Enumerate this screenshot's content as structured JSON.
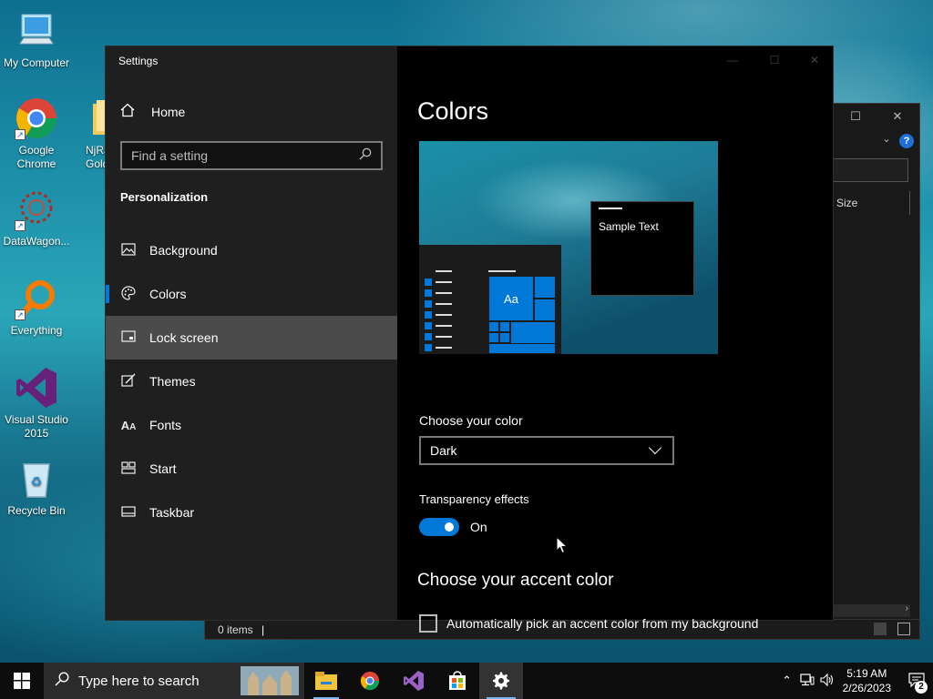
{
  "desktop": {
    "icons": [
      {
        "label": "My Computer"
      },
      {
        "label": "Google Chrome"
      },
      {
        "label": "NjRa Gold"
      },
      {
        "label": "DataWagon..."
      },
      {
        "label": "Everything"
      },
      {
        "label": "Visual Studio 2015"
      },
      {
        "label": "Recycle Bin"
      }
    ]
  },
  "explorer": {
    "column_size": "Size",
    "status_items": "0 items",
    "help": "?"
  },
  "settings": {
    "window_title": "Settings",
    "home_label": "Home",
    "search_placeholder": "Find a setting",
    "section": "Personalization",
    "nav": [
      {
        "label": "Background",
        "icon": "image-icon"
      },
      {
        "label": "Colors",
        "icon": "palette-icon"
      },
      {
        "label": "Lock screen",
        "icon": "lock-screen-icon"
      },
      {
        "label": "Themes",
        "icon": "brush-icon"
      },
      {
        "label": "Fonts",
        "icon": "font-icon"
      },
      {
        "label": "Start",
        "icon": "start-icon"
      },
      {
        "label": "Taskbar",
        "icon": "taskbar-icon"
      }
    ],
    "page_title": "Colors",
    "preview": {
      "sample_text": "Sample Text",
      "tile_text": "Aa"
    },
    "choose_color_label": "Choose your color",
    "choose_color_value": "Dark",
    "transparency_label": "Transparency effects",
    "transparency_state": "On",
    "accent_title": "Choose your accent color",
    "accent_checkbox_label": "Automatically pick an accent color from my background",
    "accent_color": "#0078d7"
  },
  "taskbar": {
    "search_text": "Type here to search",
    "apps": [
      "file-explorer",
      "chrome",
      "visual-studio",
      "store",
      "settings"
    ],
    "time": "5:19 AM",
    "date": "2/26/2023",
    "notification_count": "2"
  }
}
